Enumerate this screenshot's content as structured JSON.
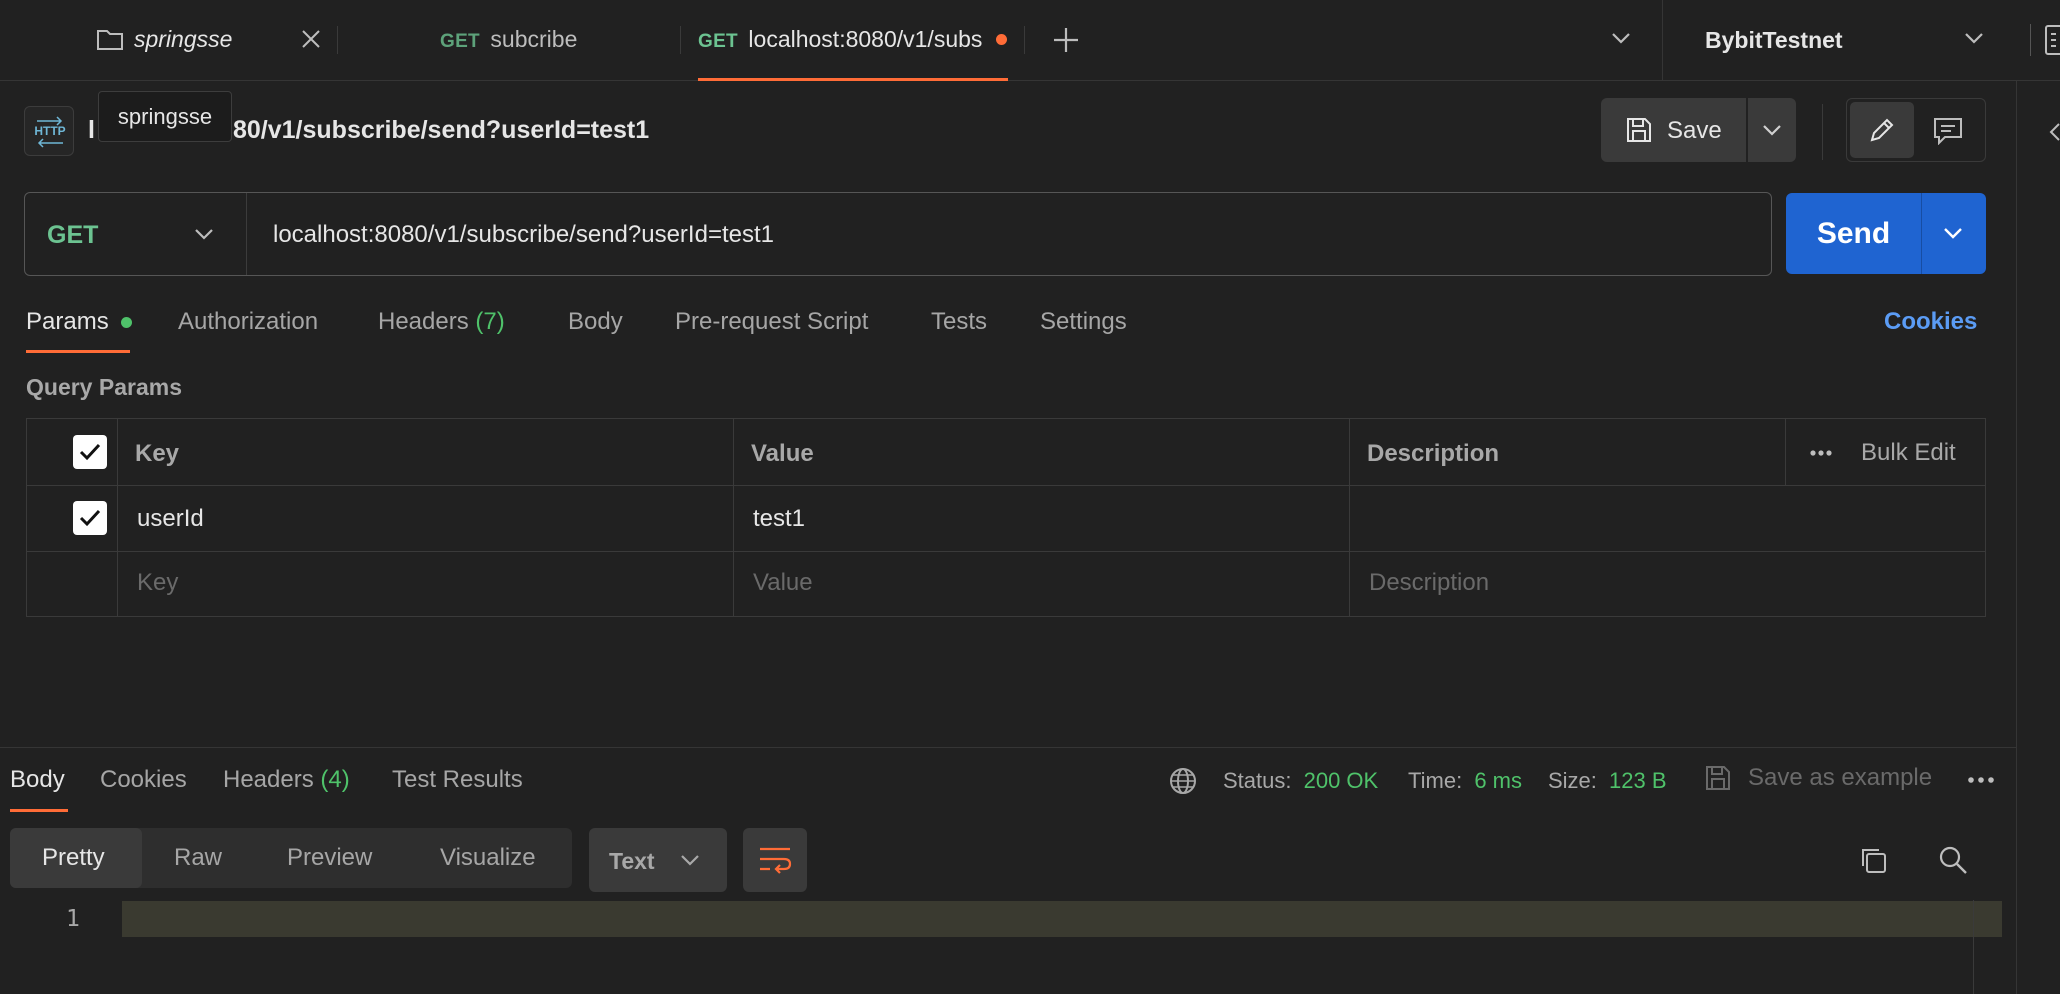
{
  "tabs": {
    "collection": {
      "label": "springsse",
      "icon": "folder-icon"
    },
    "items": [
      {
        "method": "GET",
        "label": "subcribe"
      },
      {
        "method": "GET",
        "label": "localhost:8080/v1/subs"
      }
    ],
    "environment": "BybitTestnet"
  },
  "tooltip": "springsse",
  "request": {
    "title_visible": "80/v1/subscribe/send?userId=test1",
    "title_prefix": "l",
    "save_label": "Save",
    "method": "GET",
    "url": "localhost:8080/v1/subscribe/send?userId=test1",
    "send_label": "Send"
  },
  "request_tabs": {
    "params": "Params",
    "authorization": "Authorization",
    "headers": "Headers",
    "headers_count": "(7)",
    "body": "Body",
    "prerequest": "Pre-request Script",
    "tests": "Tests",
    "settings": "Settings",
    "cookies": "Cookies"
  },
  "query_params": {
    "title": "Query Params",
    "headers": {
      "key": "Key",
      "value": "Value",
      "description": "Description",
      "bulk_edit": "Bulk Edit"
    },
    "rows": [
      {
        "key": "userId",
        "value": "test1",
        "description": ""
      }
    ],
    "placeholders": {
      "key": "Key",
      "value": "Value",
      "description": "Description"
    }
  },
  "response": {
    "tabs": {
      "body": "Body",
      "cookies": "Cookies",
      "headers": "Headers",
      "headers_count": "(4)",
      "test_results": "Test Results"
    },
    "status_label": "Status:",
    "status_value": "200 OK",
    "time_label": "Time:",
    "time_value": "6 ms",
    "size_label": "Size:",
    "size_value": "123 B",
    "save_example": "Save as example",
    "views": {
      "pretty": "Pretty",
      "raw": "Raw",
      "preview": "Preview",
      "visualize": "Visualize"
    },
    "format": "Text",
    "line_number": "1"
  },
  "colors": {
    "accent_orange": "#ff6c37",
    "send_blue": "#1f64d1",
    "green": "#4fc26a",
    "cookies_blue": "#5b9cf5",
    "get_green": "#6cc391"
  }
}
